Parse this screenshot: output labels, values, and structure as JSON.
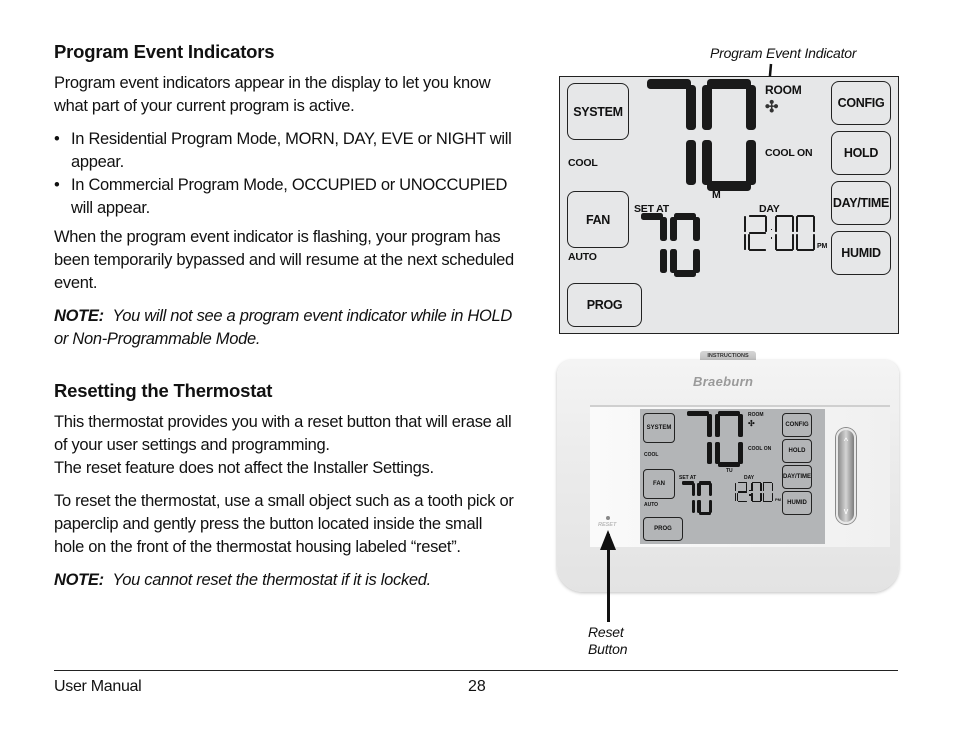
{
  "section1": {
    "heading": "Program Event Indicators",
    "intro": "Program event indicators appear in the display to let you know what part of your current program is active.",
    "bullets": [
      "In Residential Program Mode, MORN, DAY, EVE or NIGHT will appear.",
      "In Commercial Program Mode, OCCUPIED or UNOCCUPIED will appear."
    ],
    "bullet_symbol": "•",
    "flashing_text": "When the program event indicator is flashing, your program has been temporarily bypassed and will resume at the next scheduled event.",
    "note_label": "NOTE:",
    "note_text": "You will not see a program event indicator while in HOLD or Non-Programmable Mode."
  },
  "section2": {
    "heading": "Resetting the Thermostat",
    "para1_line1": "This thermostat provides you with a reset button that will erase all of your user settings and programming.",
    "para1_line2": "The reset feature does not affect the Installer Settings.",
    "para2": "To reset the thermostat, use a small object such as a tooth pick or paperclip and gently press the button located inside the small hole on the front of the thermostat housing labeled “reset”.",
    "note_label": "NOTE:",
    "note_text": "You cannot reset the thermostat if it is locked."
  },
  "diagram_display": {
    "callout": "Program Event Indicator",
    "buttons_left": [
      "SYSTEM",
      "FAN",
      "PROG"
    ],
    "buttons_right": [
      "CONFIG",
      "HOLD",
      "DAY/TIME",
      "HUMID"
    ],
    "mode_system": "COOL",
    "mode_fan": "AUTO",
    "room_label": "ROOM",
    "cool_on_label": "COOL ON",
    "day_of_week": "M",
    "set_at_label": "SET AT",
    "event_label": "DAY",
    "room_temp": "70",
    "set_temp": "70",
    "time": "12:00",
    "ampm": "PM",
    "fan_icon": "fan-icon"
  },
  "device_photo": {
    "tab_label": "INSTRUCTIONS",
    "brand": "Braeburn",
    "buttons_left": [
      "SYSTEM",
      "FAN",
      "PROG"
    ],
    "buttons_right": [
      "CONFIG",
      "HOLD",
      "DAY/TIME",
      "HUMID"
    ],
    "mode_system": "COOL",
    "mode_fan": "AUTO",
    "room_label": "ROOM",
    "cool_on_label": "COOL ON",
    "day_of_week": "TU",
    "set_at_label": "SET AT",
    "event_label": "DAY",
    "room_temp": "70",
    "set_temp": "70",
    "time": "12:00",
    "ampm": "PM",
    "reset_label": "RESET",
    "up_symbol": "^",
    "down_symbol": "v",
    "callout": "Reset Button"
  },
  "footer": {
    "title": "User Manual",
    "page": "28"
  }
}
